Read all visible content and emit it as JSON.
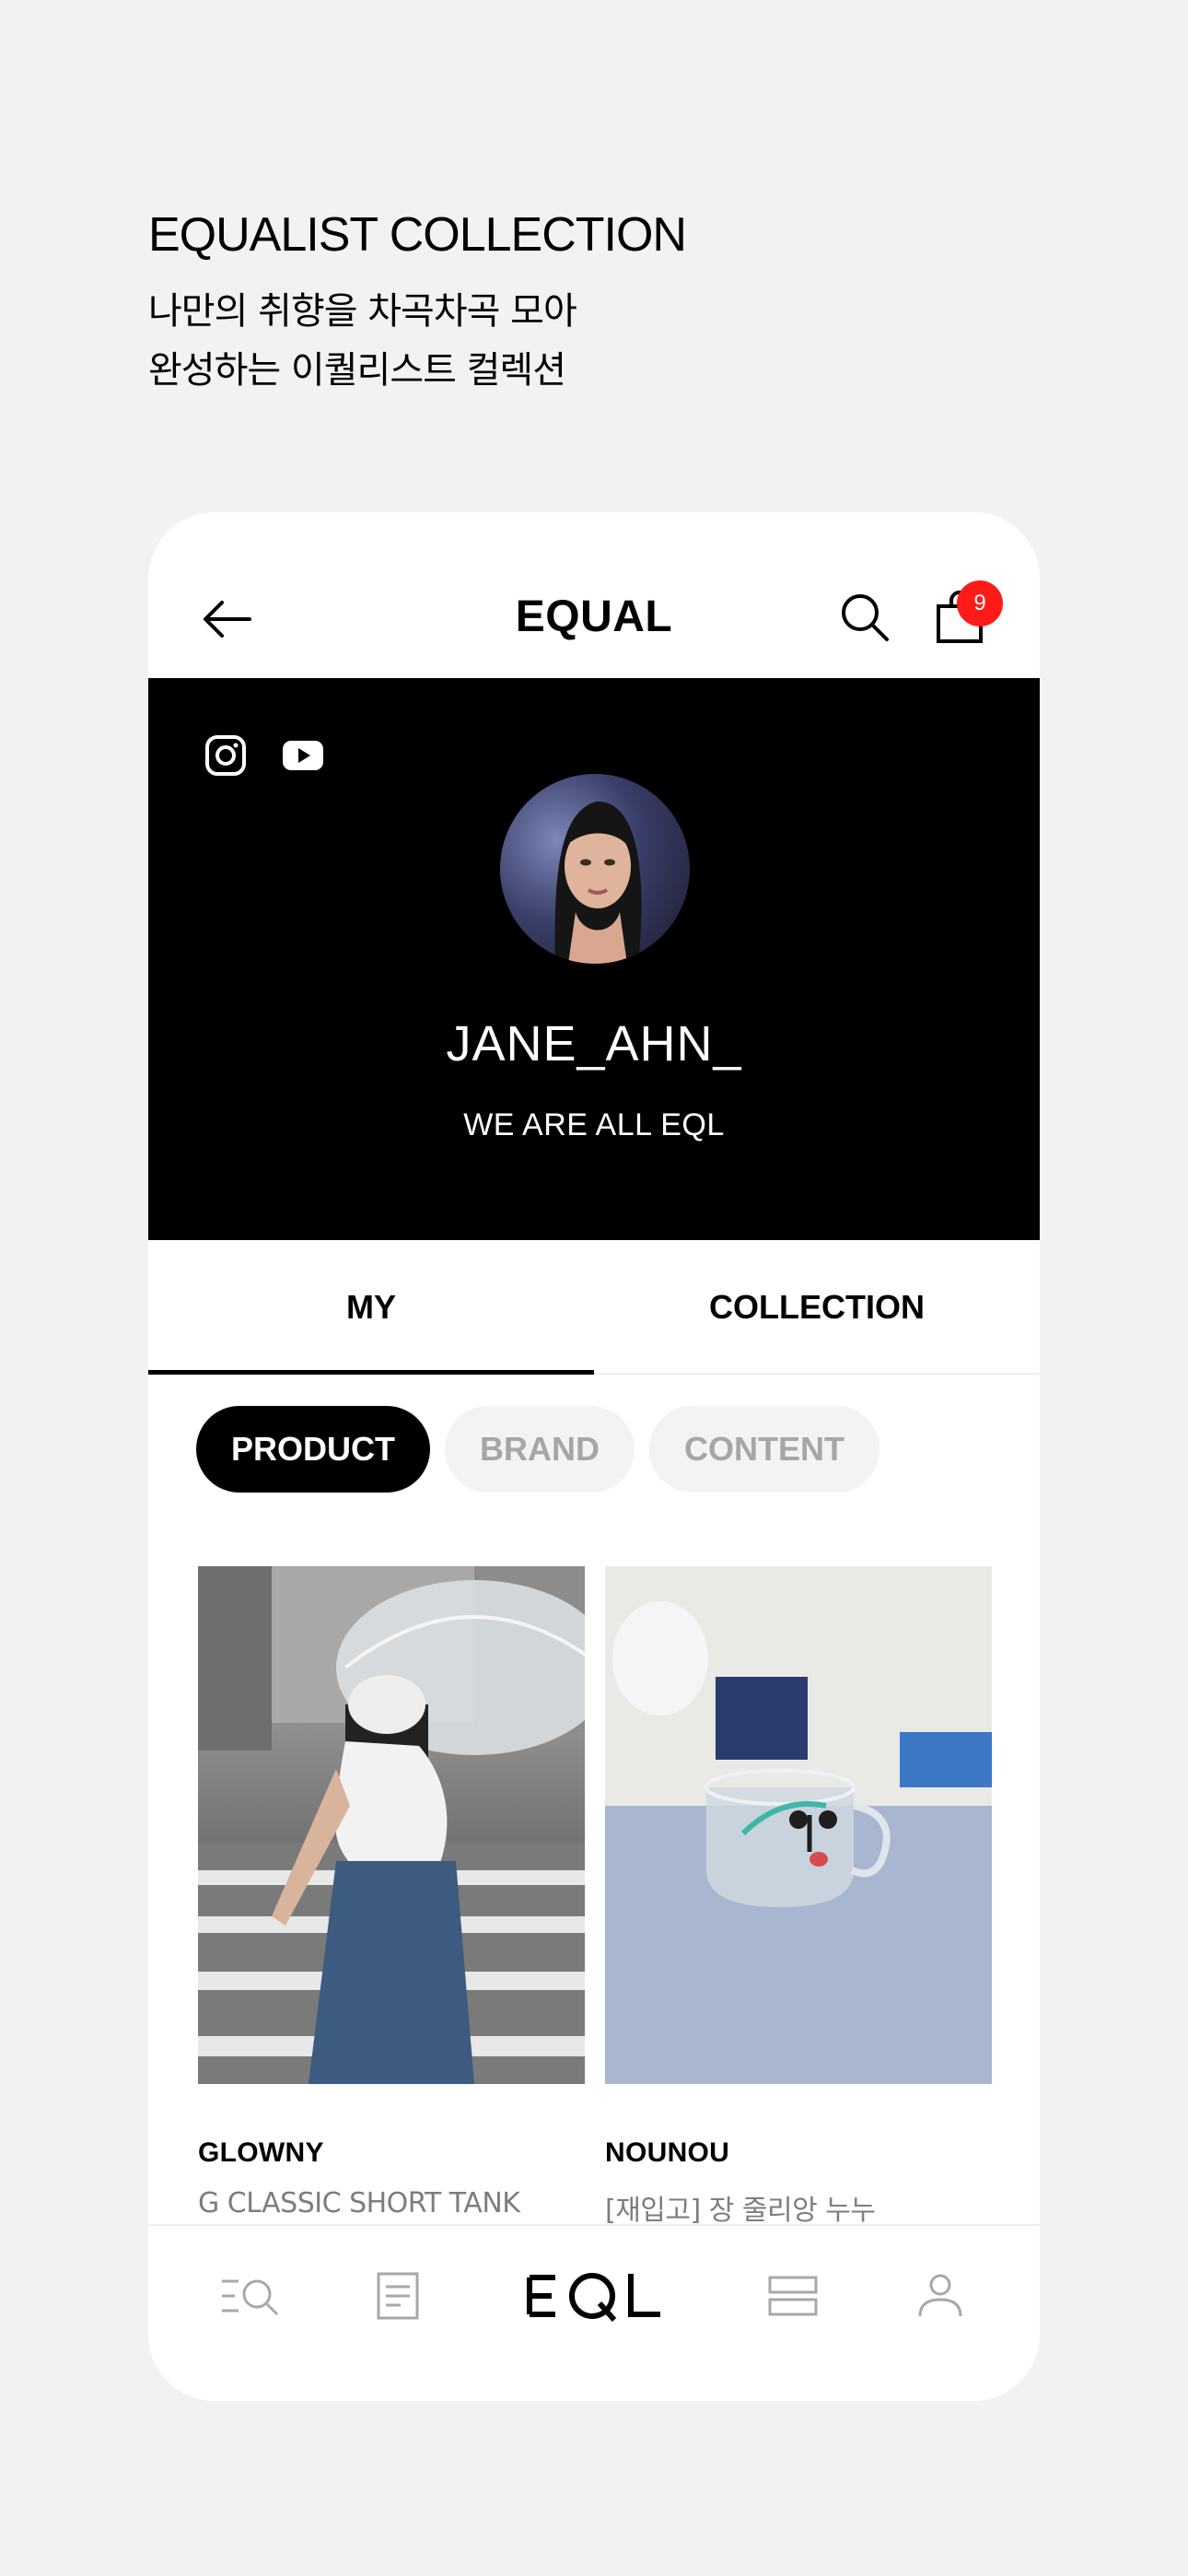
{
  "promo": {
    "title": "EQUALIST COLLECTION",
    "subtitle_line1": "나만의 취향을 차곡차곡 모아",
    "subtitle_line2": "완성하는 이퀄리스트 컬렉션"
  },
  "header": {
    "title": "EQUAL",
    "cart_count": "9",
    "badge_color": "#ff1a1a"
  },
  "profile": {
    "username": "JANE_AHN_",
    "tagline": "WE ARE ALL EQL",
    "social": [
      "instagram-icon",
      "youtube-icon"
    ]
  },
  "tabs": [
    {
      "label": "MY",
      "active": true
    },
    {
      "label": "COLLECTION",
      "active": false
    }
  ],
  "chips": [
    {
      "label": "PRODUCT",
      "active": true
    },
    {
      "label": "BRAND",
      "active": false
    },
    {
      "label": "CONTENT",
      "active": false
    }
  ],
  "products": [
    {
      "brand": "GLOWNY",
      "name": "G CLASSIC SHORT TANK"
    },
    {
      "brand": "NOUNOU",
      "name": "[재입고] 장 줄리앙 누누"
    }
  ],
  "bottom_nav": {
    "logo": "EQL",
    "items": [
      "search-menu-icon",
      "document-icon",
      "eql-home-logo",
      "layers-icon",
      "profile-icon"
    ]
  }
}
